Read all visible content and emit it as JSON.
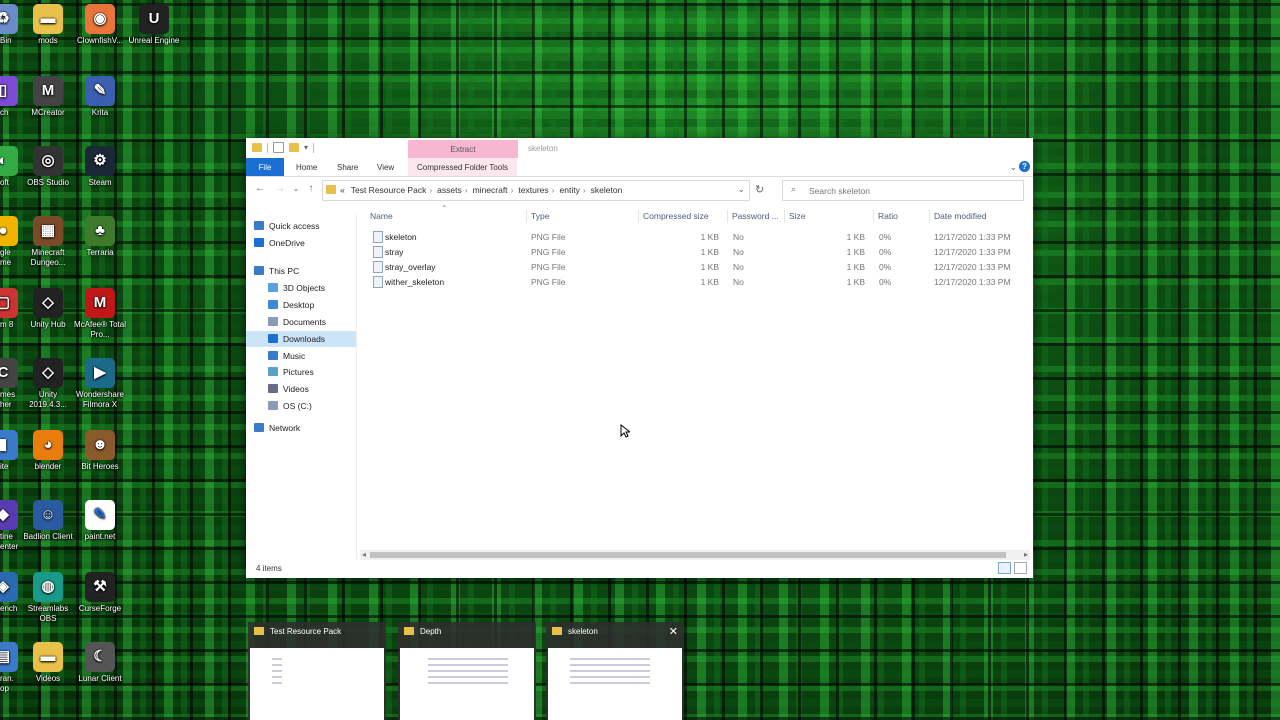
{
  "desktop_icons": [
    {
      "id": "recycle-bin",
      "label": "Bin",
      "color": "#6a8cc8",
      "glyph": "♻"
    },
    {
      "id": "mods",
      "label": "mods",
      "color": "#e8c04a",
      "glyph": "▬"
    },
    {
      "id": "clownfish",
      "label": "ClownfishV...",
      "color": "#e8753a",
      "glyph": "◉"
    },
    {
      "id": "unreal",
      "label": "Unreal Engine",
      "color": "#222222",
      "glyph": "U"
    },
    {
      "id": "twitch",
      "label": "ch",
      "color": "#7b4bd3",
      "glyph": "▯"
    },
    {
      "id": "mcreator",
      "label": "MCreator",
      "color": "#444444",
      "glyph": "M"
    },
    {
      "id": "krita",
      "label": "Krita",
      "color": "#3a5fb0",
      "glyph": "✎"
    },
    {
      "id": "soft",
      "label": "oft",
      "color": "#33aa44",
      "glyph": "◐"
    },
    {
      "id": "obs",
      "label": "OBS Studio",
      "color": "#333333",
      "glyph": "◎"
    },
    {
      "id": "steam",
      "label": "Steam",
      "color": "#1b2838",
      "glyph": "⚙"
    },
    {
      "id": "google",
      "label": "gle me",
      "color": "#f0b400",
      "glyph": "●"
    },
    {
      "id": "mc-dungeons",
      "label": "Minecraft Dungeo...",
      "color": "#7a4a2a",
      "glyph": "▦"
    },
    {
      "id": "terraria",
      "label": "Terraria",
      "color": "#3d7a2a",
      "glyph": "♣"
    },
    {
      "id": "m8",
      "label": "m 8",
      "color": "#cc3333",
      "glyph": "▢"
    },
    {
      "id": "unity-hub",
      "label": "Unity Hub",
      "color": "#222222",
      "glyph": "◇"
    },
    {
      "id": "mcafee",
      "label": "McAfee® Total Pro...",
      "color": "#c01818",
      "glyph": "M"
    },
    {
      "id": "games",
      "label": "mes her",
      "color": "#444444",
      "glyph": "C"
    },
    {
      "id": "unity2019",
      "label": "Unity 2019.4.3...",
      "color": "#222222",
      "glyph": "◇"
    },
    {
      "id": "filmora",
      "label": "Wondershare Filmora X",
      "color": "#1a6a8a",
      "glyph": "▶"
    },
    {
      "id": "site",
      "label": "ite",
      "color": "#3a7ac8",
      "glyph": "▮"
    },
    {
      "id": "blender",
      "label": "blender",
      "color": "#e87d0d",
      "glyph": "◕"
    },
    {
      "id": "bit-heroes",
      "label": "Bit Heroes",
      "color": "#8a5a2a",
      "glyph": "☻"
    },
    {
      "id": "center",
      "label": "tine enter",
      "color": "#5a3ab0",
      "glyph": "◆"
    },
    {
      "id": "badlion",
      "label": "Badlion Client",
      "color": "#2a5aa0",
      "glyph": "☺"
    },
    {
      "id": "paint",
      "label": "paint.net",
      "color": "#ffffff",
      "glyph": "✎"
    },
    {
      "id": "bench",
      "label": "ench",
      "color": "#2a6ab0",
      "glyph": "◈"
    },
    {
      "id": "streamlabs",
      "label": "Streamlabs OBS",
      "color": "#1a9a8a",
      "glyph": "◍"
    },
    {
      "id": "curseforge",
      "label": "CurseForge",
      "color": "#222222",
      "glyph": "⚒"
    },
    {
      "id": "transl",
      "label": "ran. op",
      "color": "#3a7ac8",
      "glyph": "▤"
    },
    {
      "id": "videos-desk",
      "label": "Videos",
      "color": "#e8c04a",
      "glyph": "▬"
    },
    {
      "id": "lunar",
      "label": "Lunar Client",
      "color": "#555555",
      "glyph": "☾"
    }
  ],
  "window": {
    "contextual_tab": "Extract",
    "title": "skeleton",
    "ribbon_tabs": [
      "File",
      "Home",
      "Share",
      "View",
      "Compressed Folder Tools"
    ],
    "help": "?",
    "breadcrumb_prefix": "«",
    "breadcrumb": [
      "Test Resource Pack",
      "assets",
      "minecraft",
      "textures",
      "entity",
      "skeleton"
    ],
    "search_placeholder": "Search skeleton",
    "nav_items": [
      {
        "label": "Quick access",
        "color": "#3a7ac8"
      },
      {
        "label": "OneDrive",
        "color": "#1c6fd2"
      },
      {
        "label": "This PC",
        "color": "#3a7ac8"
      },
      {
        "label": "3D Objects",
        "color": "#5aa0e0"
      },
      {
        "label": "Desktop",
        "color": "#3a8ad8"
      },
      {
        "label": "Documents",
        "color": "#8a9ab8"
      },
      {
        "label": "Downloads",
        "color": "#1c6fd2"
      },
      {
        "label": "Music",
        "color": "#3a7ac8"
      },
      {
        "label": "Pictures",
        "color": "#5aa0c8"
      },
      {
        "label": "Videos",
        "color": "#6a6a8a"
      },
      {
        "label": "OS (C:)",
        "color": "#8a9ab8"
      },
      {
        "label": "Network",
        "color": "#3a7ac8"
      }
    ],
    "selected_nav": "Downloads",
    "columns": [
      "Name",
      "Type",
      "Compressed size",
      "Password ...",
      "Size",
      "Ratio",
      "Date modified"
    ],
    "files": [
      {
        "name": "skeleton",
        "type": "PNG File",
        "compressed": "1 KB",
        "password": "No",
        "size": "1 KB",
        "ratio": "0%",
        "date": "12/17/2020 1:33 PM"
      },
      {
        "name": "stray",
        "type": "PNG File",
        "compressed": "1 KB",
        "password": "No",
        "size": "1 KB",
        "ratio": "0%",
        "date": "12/17/2020 1:33 PM"
      },
      {
        "name": "stray_overlay",
        "type": "PNG File",
        "compressed": "1 KB",
        "password": "No",
        "size": "1 KB",
        "ratio": "0%",
        "date": "12/17/2020 1:33 PM"
      },
      {
        "name": "wither_skeleton",
        "type": "PNG File",
        "compressed": "1 KB",
        "password": "No",
        "size": "1 KB",
        "ratio": "0%",
        "date": "12/17/2020 1:33 PM"
      }
    ],
    "status": "4 items"
  },
  "taskbar_previews": [
    {
      "title": "Test Resource Pack"
    },
    {
      "title": "Depth"
    },
    {
      "title": "skeleton"
    }
  ],
  "colors": {
    "accent": "#1c6fd2",
    "extract_tab": "#f7b7d0",
    "selection": "#cce4f7"
  }
}
